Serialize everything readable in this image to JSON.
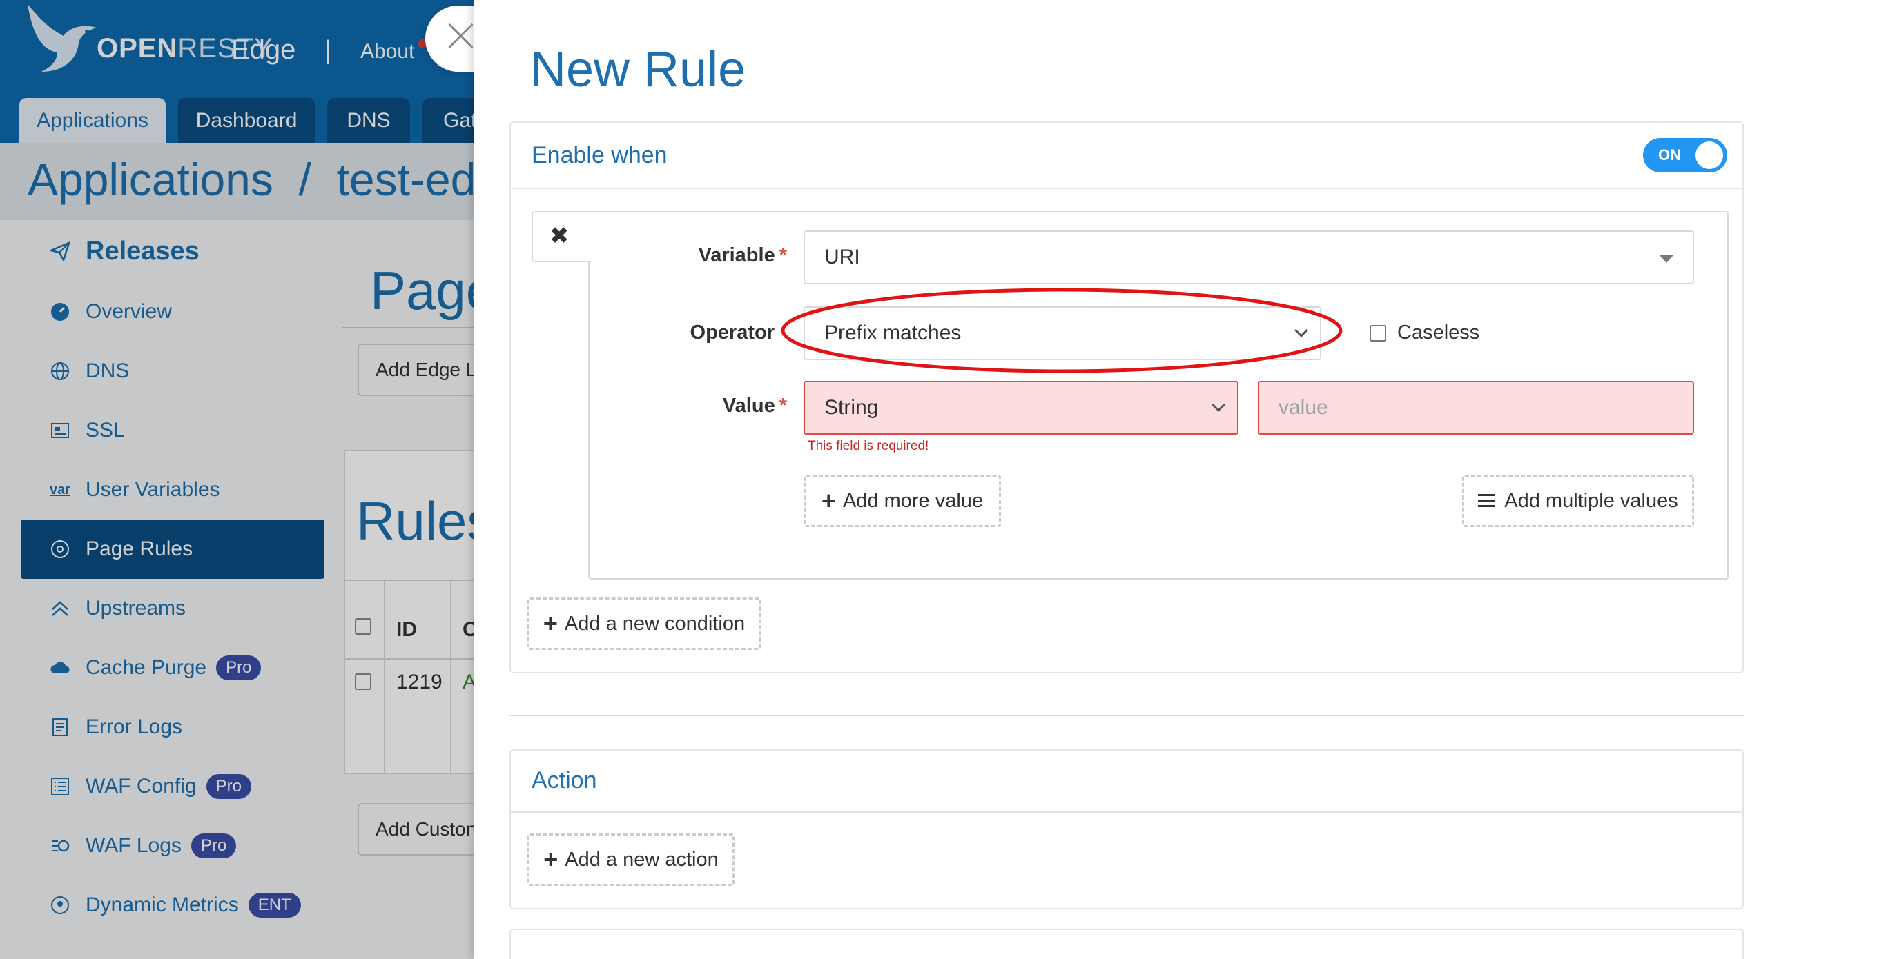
{
  "app": {
    "logo_text_bold": "OPEN",
    "logo_text_thin": "RESTY",
    "logo_product": "Edge",
    "separator": "|",
    "about": "About"
  },
  "nav_tabs": [
    {
      "label": "Applications",
      "active": true
    },
    {
      "label": "Dashboard",
      "active": false
    },
    {
      "label": "DNS",
      "active": false
    },
    {
      "label": "Gat",
      "active": false
    }
  ],
  "breadcrumb": "Applications  /  test-edge",
  "sidebar": {
    "items": [
      {
        "label": "Releases",
        "icon": "paper-plane-icon",
        "head": true
      },
      {
        "label": "Overview",
        "icon": "dashboard-icon"
      },
      {
        "label": "DNS",
        "icon": "globe-icon"
      },
      {
        "label": "SSL",
        "icon": "certificate-icon"
      },
      {
        "label": "User Variables",
        "icon": "var-icon"
      },
      {
        "label": "Page Rules",
        "icon": "rules-icon",
        "active": true
      },
      {
        "label": "Upstreams",
        "icon": "chevrons-up-icon"
      },
      {
        "label": "Cache Purge",
        "icon": "cloud-icon",
        "badge": "Pro"
      },
      {
        "label": "Error Logs",
        "icon": "log-file-icon"
      },
      {
        "label": "WAF Config",
        "icon": "list-icon",
        "badge": "Pro"
      },
      {
        "label": "WAF Logs",
        "icon": "waf-log-icon",
        "badge": "Pro"
      },
      {
        "label": "Dynamic Metrics",
        "icon": "metrics-icon",
        "badge": "ENT"
      }
    ]
  },
  "background_page": {
    "title": "Page",
    "add_edge_btn": "Add Edge L",
    "rules_title": "Rules",
    "table_headers": [
      "ID",
      "C"
    ],
    "row_id": "1219",
    "row_col": "A",
    "add_custom_btn": "Add Custon"
  },
  "modal": {
    "title": "New Rule",
    "enable_when": {
      "title": "Enable when",
      "toggle_label": "ON",
      "toggle_on": true,
      "condition": {
        "variable_label": "Variable",
        "variable_value": "URI",
        "operator_label": "Operator",
        "operator_value": "Prefix matches",
        "caseless_label": "Caseless",
        "value_label": "Value",
        "value_type": "String",
        "value_placeholder": "value",
        "error_text": "This field is required!",
        "add_more_value": "Add more value",
        "add_multiple_values": "Add multiple values"
      },
      "add_condition": "Add a new condition"
    },
    "action": {
      "title": "Action",
      "add_action": "Add a new action"
    }
  },
  "colors": {
    "brand_blue": "#0f6aae",
    "accent_blue": "#1d6fae",
    "toggle_blue": "#2196f3",
    "error_red": "#e04848",
    "annotation_red": "#e01414"
  }
}
